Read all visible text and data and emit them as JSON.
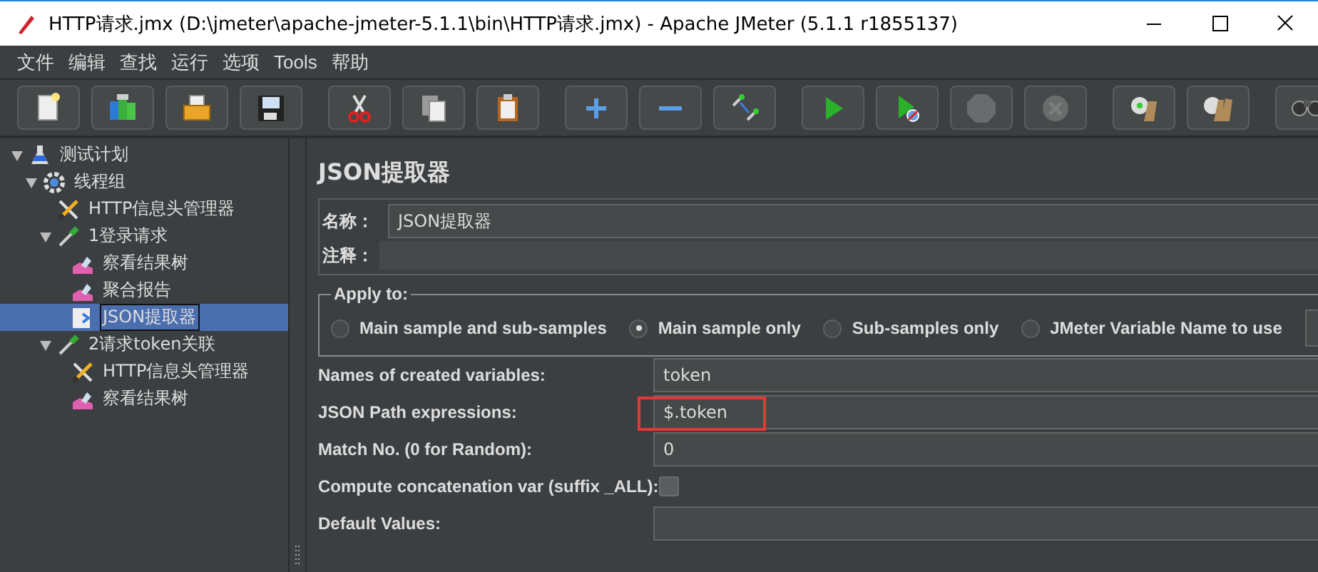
{
  "window": {
    "title": "HTTP请求.jmx (D:\\jmeter\\apache-jmeter-5.1.1\\bin\\HTTP请求.jmx) - Apache JMeter (5.1.1 r1855137)"
  },
  "menu": [
    {
      "label": "文件"
    },
    {
      "label": "编辑"
    },
    {
      "label": "查找"
    },
    {
      "label": "运行"
    },
    {
      "label": "选项"
    },
    {
      "label": "Tools"
    },
    {
      "label": "帮助"
    }
  ],
  "toolbar": [
    {
      "kind": "new",
      "disabled": false
    },
    {
      "kind": "templates",
      "disabled": false
    },
    {
      "kind": "open",
      "disabled": false
    },
    {
      "kind": "save",
      "disabled": false
    },
    {
      "kind": "cut",
      "disabled": false
    },
    {
      "kind": "copy",
      "disabled": false
    },
    {
      "kind": "paste",
      "disabled": false
    },
    {
      "kind": "expand",
      "disabled": false
    },
    {
      "kind": "collapse",
      "disabled": false
    },
    {
      "kind": "toggle",
      "disabled": false
    },
    {
      "kind": "start",
      "disabled": false
    },
    {
      "kind": "start-no-pause",
      "disabled": false
    },
    {
      "kind": "stop",
      "disabled": true
    },
    {
      "kind": "shutdown",
      "disabled": true
    },
    {
      "kind": "clear",
      "disabled": false
    },
    {
      "kind": "clear-all",
      "disabled": false
    },
    {
      "kind": "search",
      "disabled": false
    }
  ],
  "tree": [
    {
      "label": "测试计划",
      "kind": "test-plan",
      "expanded": true,
      "selected": false,
      "children": [
        {
          "label": "线程组",
          "kind": "thread-group",
          "expanded": true,
          "selected": false,
          "children": [
            {
              "label": "HTTP信息头管理器",
              "kind": "header-manager",
              "selected": false
            },
            {
              "label": "1登录请求",
              "kind": "sampler",
              "expanded": true,
              "selected": false,
              "children": [
                {
                  "label": "察看结果树",
                  "kind": "listener",
                  "selected": false
                },
                {
                  "label": "聚合报告",
                  "kind": "listener",
                  "selected": false
                },
                {
                  "label": "JSON提取器",
                  "kind": "extractor",
                  "selected": true
                }
              ]
            },
            {
              "label": "2请求token关联",
              "kind": "sampler",
              "expanded": true,
              "selected": false,
              "children": [
                {
                  "label": "HTTP信息头管理器",
                  "kind": "header-manager",
                  "selected": false
                },
                {
                  "label": "察看结果树",
                  "kind": "listener",
                  "selected": false
                }
              ]
            }
          ]
        }
      ]
    }
  ],
  "editor": {
    "title": "JSON提取器",
    "name_label": "名称：",
    "name_value": "JSON提取器",
    "comment_label": "注释：",
    "apply_to": {
      "legend": "Apply to:",
      "options": [
        {
          "label": "Main sample and sub-samples",
          "selected": false
        },
        {
          "label": "Main sample only",
          "selected": true
        },
        {
          "label": "Sub-samples only",
          "selected": false
        },
        {
          "label": "JMeter Variable Name to use",
          "selected": false
        }
      ]
    },
    "fields": [
      {
        "kind": "text",
        "label": "Names of created variables:",
        "value": "token",
        "highlighted": false
      },
      {
        "kind": "text",
        "label": "JSON Path expressions:",
        "value": "$.token",
        "highlighted": true
      },
      {
        "kind": "text",
        "label": "Match No. (0 for Random):",
        "value": "0",
        "highlighted": false
      },
      {
        "kind": "checkbox",
        "label": "Compute concatenation var (suffix _ALL):",
        "checked": false
      },
      {
        "kind": "text",
        "label": "Default Values:",
        "highlighted": false
      }
    ]
  }
}
